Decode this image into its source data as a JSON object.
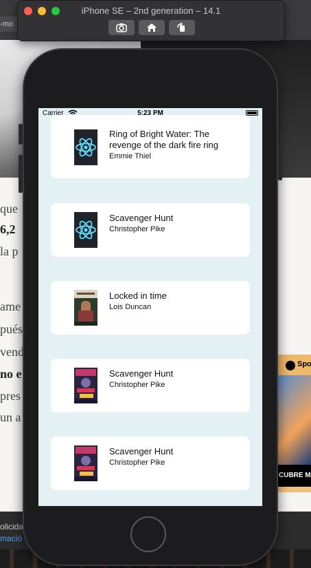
{
  "simulator": {
    "title": "iPhone SE – 2nd generation – 14.1",
    "buttons": [
      {
        "name": "screenshot-button",
        "icon": "camera-icon"
      },
      {
        "name": "home-button",
        "icon": "house-icon"
      },
      {
        "name": "rotate-button",
        "icon": "rotate-icon"
      }
    ]
  },
  "background": {
    "tab_text": "-mo",
    "article_lines": [
      "que",
      "6,2",
      "la p",
      "ame",
      "pués",
      "vend",
      "no e",
      "pres",
      "un a"
    ],
    "ad_brand": "Spo",
    "ad_cta": "CUBRE M",
    "footer_text": "olicida",
    "footer_link": "mació"
  },
  "status_bar": {
    "carrier": "Carrier",
    "time": "5:23 PM"
  },
  "books": [
    {
      "title": "Ring of Bright Water: The revenge of the dark fire ring",
      "author": "Emmie Thiel",
      "cover": "react-logo-icon"
    },
    {
      "title": "Scavenger Hunt",
      "author": "Christopher Pike",
      "cover": "react-logo-icon"
    },
    {
      "title": "Locked in time",
      "author": "Lois Duncan",
      "cover": "book-cover-locked-in-time"
    },
    {
      "title": "Scavenger Hunt",
      "author": "Christopher Pike",
      "cover": "book-cover-scavenger-hunt"
    },
    {
      "title": "Scavenger Hunt",
      "author": "Christopher Pike",
      "cover": "book-cover-scavenger-hunt"
    }
  ],
  "colors": {
    "screen_bg": "#e3f1f5",
    "card_bg": "#ffffff",
    "react_cyan": "#61dafb"
  }
}
